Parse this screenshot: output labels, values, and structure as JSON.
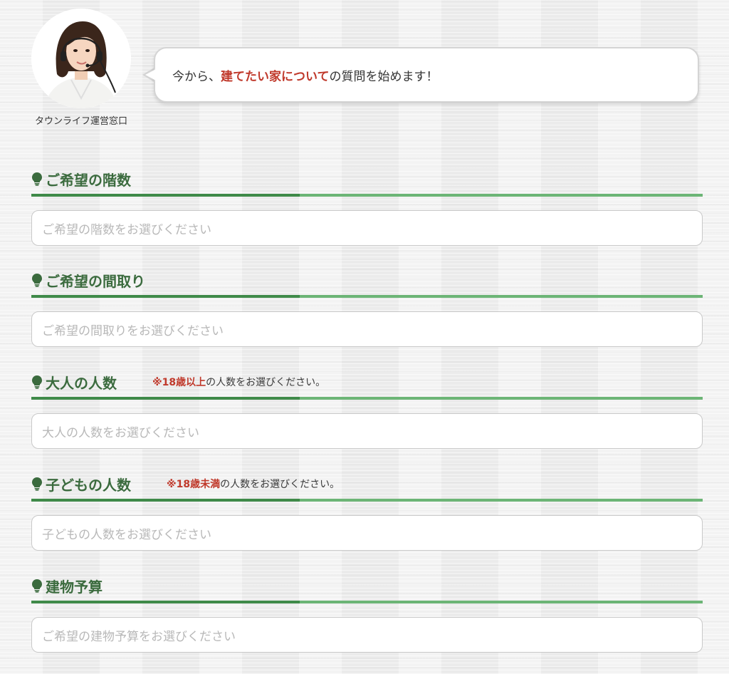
{
  "operator": {
    "name": "タウンライフ運営窓口"
  },
  "message": {
    "prefix": "今から、",
    "highlight": "建てたい家について",
    "suffix": "の質問を始めます！"
  },
  "sections": [
    {
      "title": "ご希望の階数",
      "placeholder": "ご希望の階数をお選びください"
    },
    {
      "title": "ご希望の間取り",
      "placeholder": "ご希望の間取りをお選びください"
    },
    {
      "title": "大人の人数",
      "note_prefix": "※18歳以上",
      "note_suffix": "の人数をお選びください。",
      "placeholder": "大人の人数をお選びください"
    },
    {
      "title": "子どもの人数",
      "note_prefix": "※18歳未満",
      "note_suffix": "の人数をお選びください。",
      "placeholder": "子どもの人数をお選びください"
    },
    {
      "title": "建物予算",
      "placeholder": "ご希望の建物予算をお選びください"
    }
  ],
  "colors": {
    "accent_green": "#3b6b3e",
    "highlight_red": "#c0392b"
  },
  "icons": {
    "section": "lightbulb-icon"
  }
}
